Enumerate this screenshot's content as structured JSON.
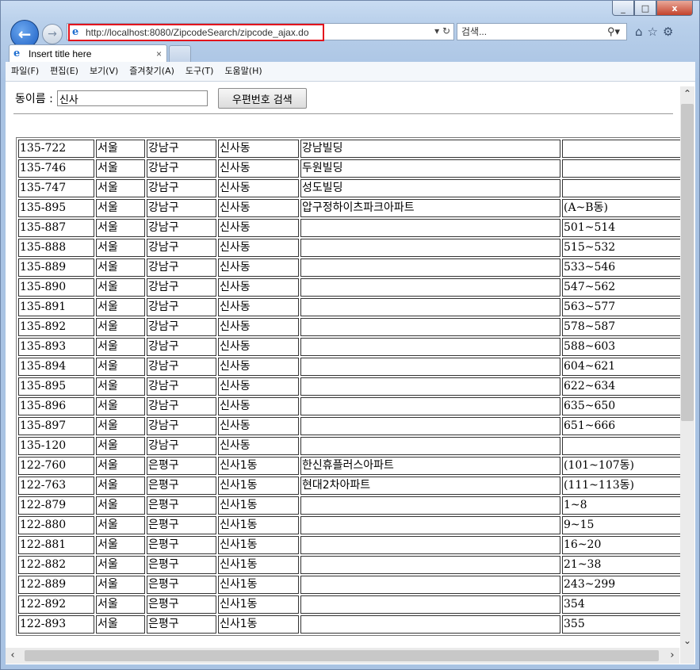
{
  "browser": {
    "window_controls": {
      "minimize": "_",
      "maximize": "□",
      "close": "x"
    },
    "url": "http://localhost:8080/ZipcodeSearch/zipcode_ajax.do",
    "search_placeholder": "검색...",
    "tab_title": "Insert title here",
    "tab_close": "×",
    "menu": [
      "파일(F)",
      "편집(E)",
      "보기(V)",
      "즐겨찾기(A)",
      "도구(T)",
      "도움말(H)"
    ],
    "highlight_color": "#e3141d"
  },
  "form": {
    "label": "동이름 :",
    "input_value": "신사",
    "button_label": "우편번호 검색"
  },
  "rows": [
    [
      "135-722",
      "서울",
      "강남구",
      "신사동",
      "강남빌딩",
      ""
    ],
    [
      "135-746",
      "서울",
      "강남구",
      "신사동",
      "두원빌딩",
      ""
    ],
    [
      "135-747",
      "서울",
      "강남구",
      "신사동",
      "성도빌딩",
      ""
    ],
    [
      "135-895",
      "서울",
      "강남구",
      "신사동",
      "압구정하이츠파크아파트",
      "(A~B동)"
    ],
    [
      "135-887",
      "서울",
      "강남구",
      "신사동",
      "",
      "501~514"
    ],
    [
      "135-888",
      "서울",
      "강남구",
      "신사동",
      "",
      "515~532"
    ],
    [
      "135-889",
      "서울",
      "강남구",
      "신사동",
      "",
      "533~546"
    ],
    [
      "135-890",
      "서울",
      "강남구",
      "신사동",
      "",
      "547~562"
    ],
    [
      "135-891",
      "서울",
      "강남구",
      "신사동",
      "",
      "563~577"
    ],
    [
      "135-892",
      "서울",
      "강남구",
      "신사동",
      "",
      "578~587"
    ],
    [
      "135-893",
      "서울",
      "강남구",
      "신사동",
      "",
      "588~603"
    ],
    [
      "135-894",
      "서울",
      "강남구",
      "신사동",
      "",
      "604~621"
    ],
    [
      "135-895",
      "서울",
      "강남구",
      "신사동",
      "",
      "622~634"
    ],
    [
      "135-896",
      "서울",
      "강남구",
      "신사동",
      "",
      "635~650"
    ],
    [
      "135-897",
      "서울",
      "강남구",
      "신사동",
      "",
      "651~666"
    ],
    [
      "135-120",
      "서울",
      "강남구",
      "신사동",
      "",
      ""
    ],
    [
      "122-760",
      "서울",
      "은평구",
      "신사1동",
      "한신휴플러스아파트",
      "(101~107동)"
    ],
    [
      "122-763",
      "서울",
      "은평구",
      "신사1동",
      "현대2차아파트",
      "(111~113동)"
    ],
    [
      "122-879",
      "서울",
      "은평구",
      "신사1동",
      "",
      "1~8"
    ],
    [
      "122-880",
      "서울",
      "은평구",
      "신사1동",
      "",
      "9~15"
    ],
    [
      "122-881",
      "서울",
      "은평구",
      "신사1동",
      "",
      "16~20"
    ],
    [
      "122-882",
      "서울",
      "은평구",
      "신사1동",
      "",
      "21~38"
    ],
    [
      "122-889",
      "서울",
      "은평구",
      "신사1동",
      "",
      "243~299"
    ],
    [
      "122-892",
      "서울",
      "은평구",
      "신사1동",
      "",
      "354"
    ],
    [
      "122-893",
      "서울",
      "은평구",
      "신사1동",
      "",
      "355"
    ]
  ]
}
